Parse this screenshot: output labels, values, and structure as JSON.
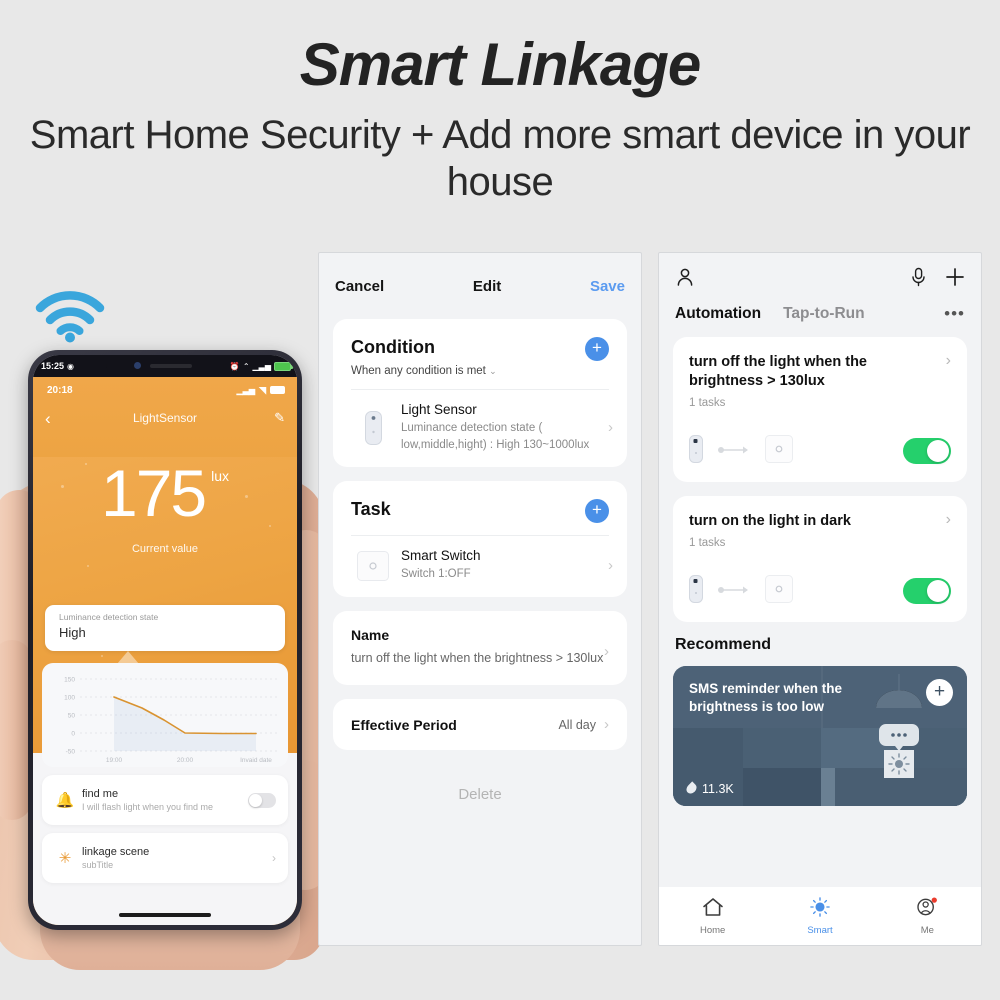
{
  "hero": {
    "title": "Smart Linkage",
    "subtitle": "Smart Home Security + Add more smart device in your house"
  },
  "phone": {
    "system_status": {
      "time": "15:25",
      "alarm_icon": "alarm-icon",
      "battery": "battery-icon"
    },
    "app_status": {
      "time": "20:18",
      "signal": "signal-icon",
      "wifi": "wifi-icon",
      "battery": "battery-icon"
    },
    "nav": {
      "back": "‹",
      "title": "LightSensor",
      "edit_icon": "pencil-icon"
    },
    "reading": {
      "value": "175",
      "unit": "lux",
      "caption": "Current value"
    },
    "luminance_card": {
      "label": "Luminance detection state",
      "value": "High"
    },
    "chart_data": {
      "type": "line",
      "title": "",
      "x": [
        "19:00",
        "20:00",
        "Invaid date"
      ],
      "xlabel": "",
      "ylabel": "",
      "ylim": [
        -50,
        160
      ],
      "yticks": [
        "150",
        "100",
        "50",
        "0",
        "-50"
      ],
      "xticks": [
        "19:00",
        "20:00",
        "Invaid date"
      ],
      "series": [
        {
          "name": "lux",
          "color": "#d99330",
          "points": [
            {
              "x": "19:00",
              "y": 102
            },
            {
              "x": "19:20",
              "y": 72
            },
            {
              "x": "19:40",
              "y": 36
            },
            {
              "x": "20:00",
              "y": 3
            },
            {
              "x": "20:30",
              "y": 2
            },
            {
              "x": "Invaid date",
              "y": 2
            }
          ]
        }
      ],
      "grid": true,
      "legend": "none"
    },
    "list": [
      {
        "icon": "bell-icon",
        "title": "find me",
        "subtitle": "I will flash light when you find me",
        "toggle": "off"
      },
      {
        "icon": "scene-icon",
        "title": "linkage scene",
        "subtitle": "subTitle",
        "chevron": "›"
      }
    ]
  },
  "edit_panel": {
    "topbar": {
      "cancel": "Cancel",
      "title": "Edit",
      "save": "Save"
    },
    "condition": {
      "heading": "Condition",
      "subheading": "When any condition is met",
      "chevron_down": "⌄",
      "add_label": "+",
      "item": {
        "icon": "light-sensor-icon",
        "title": "Light Sensor",
        "detail": "Luminance detection state ( low,middle,hight) : High 130~1000lux",
        "chevron": "›"
      }
    },
    "task": {
      "heading": "Task",
      "add_label": "+",
      "item": {
        "icon": "smart-switch-icon",
        "title": "Smart Switch",
        "detail": "Switch 1:OFF",
        "chevron": "›"
      }
    },
    "name": {
      "heading": "Name",
      "value": "turn off the light when the brightness  >  130lux",
      "chevron": "›"
    },
    "effective_period": {
      "heading": "Effective Period",
      "value": "All day",
      "chevron": "›"
    },
    "delete_label": "Delete"
  },
  "automation_panel": {
    "topbar": {
      "profile_icon": "person-icon",
      "mic_icon": "microphone-icon",
      "add_icon": "plus-icon"
    },
    "tabs": [
      {
        "label": "Automation",
        "active": true
      },
      {
        "label": "Tap-to-Run",
        "active": false
      }
    ],
    "more_label": "•••",
    "cards": [
      {
        "title": "turn off the light when the brightness  > 130lux",
        "tasks": "1 tasks",
        "chevron": "›",
        "from_icon": "light-sensor-icon",
        "arrow_icon": "arrow-right-icon",
        "to_icon": "smart-switch-icon",
        "toggle": "on"
      },
      {
        "title": "turn on the light in dark",
        "tasks": "1 tasks",
        "chevron": "›",
        "from_icon": "light-sensor-icon",
        "arrow_icon": "arrow-right-icon",
        "to_icon": "smart-switch-icon",
        "toggle": "on"
      }
    ],
    "recommend": {
      "heading": "Recommend",
      "card_title": "SMS reminder when the brightness is too low",
      "count": "11.3K",
      "add_label": "+",
      "bg_color": "#4d6277"
    },
    "bottom_nav": [
      {
        "icon": "home-icon",
        "label": "Home",
        "active": false
      },
      {
        "icon": "smart-sun-icon",
        "label": "Smart",
        "active": true
      },
      {
        "icon": "person-badge-icon",
        "label": "Me",
        "active": false
      }
    ]
  },
  "colors": {
    "accent_blue": "#4a90e8",
    "toggle_green": "#25d06c",
    "orange": "#eda443",
    "orange_dark": "#e08a20",
    "wifi_blue": "#3aa6dc"
  }
}
